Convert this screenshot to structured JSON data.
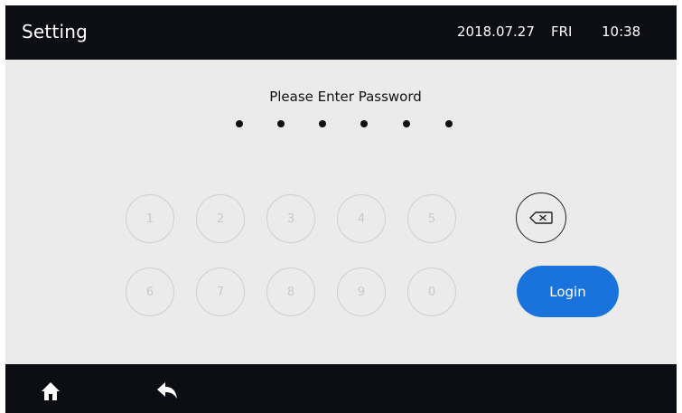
{
  "header": {
    "title": "Setting",
    "date": "2018.07.27",
    "day": "FRI",
    "time": "10:38"
  },
  "password": {
    "prompt": "Please Enter Password",
    "entered_count": 6
  },
  "keypad": {
    "row1": [
      "1",
      "2",
      "3",
      "4",
      "5"
    ],
    "row2": [
      "6",
      "7",
      "8",
      "9",
      "0"
    ],
    "backspace_icon": "backspace-icon",
    "login_label": "Login"
  },
  "footer": {
    "home_icon": "home-icon",
    "back_icon": "back-arrow-icon"
  },
  "colors": {
    "bar_background": "#0d0d14",
    "screen_background": "#ebebeb",
    "accent": "#1a73dd"
  }
}
